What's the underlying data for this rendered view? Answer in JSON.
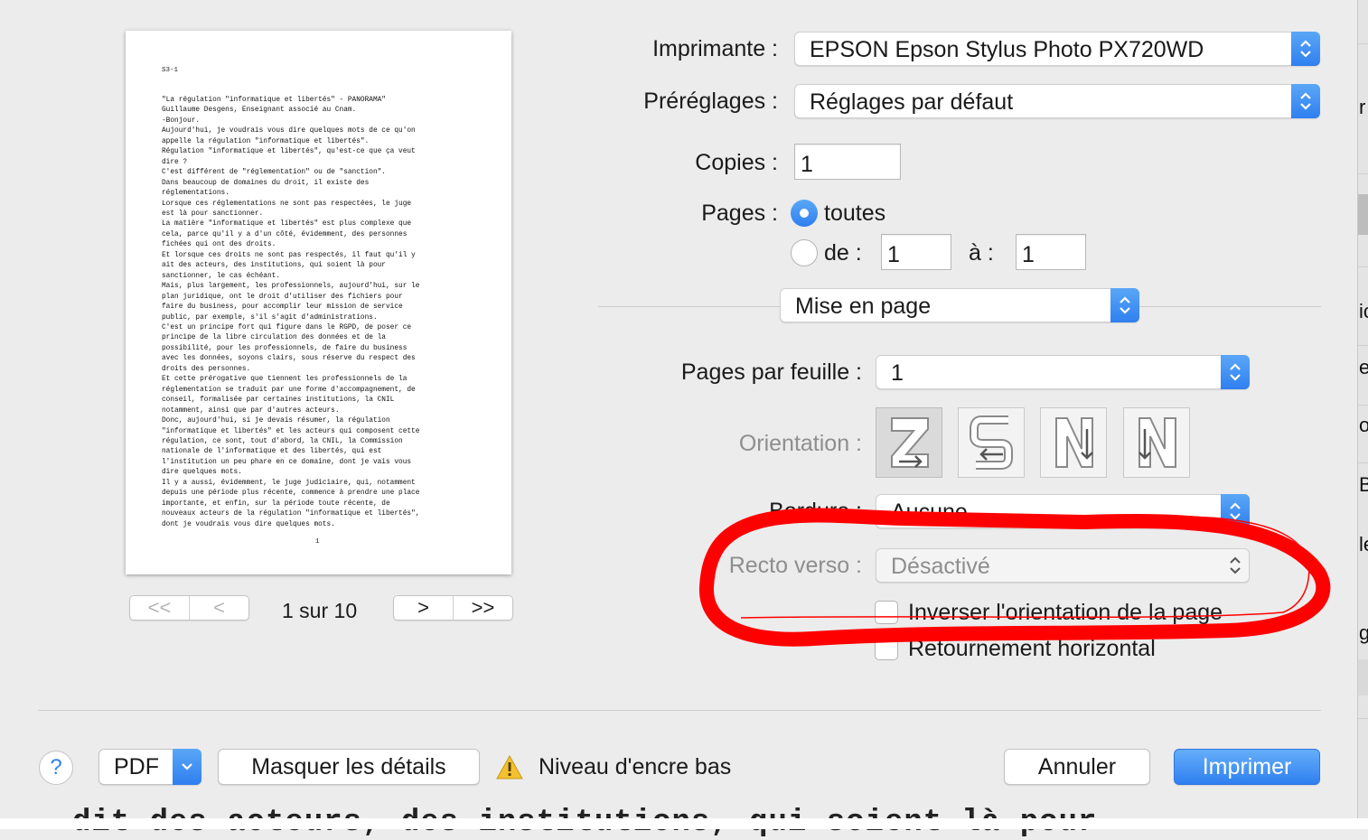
{
  "preview": {
    "doc_code": "S3-1",
    "page_number": "1",
    "lines": [
      "\"La régulation \"informatique et libertés\" - PANORAMA\"",
      "Guillaume Desgens, Enseignant associé au Cnam.",
      "-Bonjour.",
      "Aujourd'hui, je voudrais vous dire quelques mots de ce qu'on",
      "appelle la régulation \"informatique et libertés\".",
      "Régulation \"informatique et libertés\", qu'est-ce que ça veut",
      "dire ?",
      "C'est différent de \"réglementation\" ou de \"sanction\".",
      "Dans beaucoup de domaines du droit, il existe des",
      "réglementations.",
      "Lorsque ces réglementations ne sont pas respectées, le juge",
      "est là pour sanctionner.",
      "La matière \"informatique et libertés\" est plus complexe que",
      "cela, parce qu'il y a d'un côté, évidemment, des personnes",
      "fichées qui ont des droits.",
      "Et lorsque ces droits ne sont pas respectés, il faut qu'il y",
      "ait des acteurs, des institutions, qui soient là pour",
      "sanctionner, le cas échéant.",
      "Mais, plus largement, les professionnels, aujourd'hui, sur le",
      "plan juridique, ont le droit d'utiliser des fichiers pour",
      "faire du business, pour accomplir leur mission de service",
      "public, par exemple, s'il s'agit d'administrations.",
      "C'est un principe fort qui figure dans le RGPD, de poser ce",
      "principe de la libre circulation des données et de la",
      "possibilité, pour les professionnels, de faire du business",
      "avec les données, soyons clairs, sous réserve du respect des",
      "droits des personnes.",
      "Et cette prérogative que tiennent les professionnels de la",
      "réglementation se traduit par une forme d'accompagnement, de",
      "conseil, formalisée par certaines institutions, la CNIL",
      "notamment, ainsi que par d'autres acteurs.",
      "Donc, aujourd'hui, si je devais résumer, la régulation",
      "\"informatique et libertés\" et les acteurs qui composent cette",
      "régulation, ce sont, tout d'abord, la CNIL, la Commission",
      "nationale de l'informatique et des libertés, qui est",
      "l'institution un peu phare en ce domaine, dont je vais vous",
      "dire quelques mots.",
      "Il y a aussi, évidemment, le juge judiciaire, qui, notamment",
      "depuis une période plus récente, commence à prendre une place",
      "importante, et enfin, sur la période toute récente, de",
      "nouveaux acteurs de la régulation \"informatique et libertés\",",
      "dont je voudrais vous dire quelques mots."
    ],
    "page_indicator": "1 sur 10",
    "nav_first": "<<",
    "nav_prev": "<",
    "nav_next": ">",
    "nav_last": ">>"
  },
  "form": {
    "printer_label": "Imprimante :",
    "printer_value": "EPSON Epson Stylus Photo PX720WD",
    "presets_label": "Préréglages :",
    "presets_value": "Réglages par défaut",
    "copies_label": "Copies :",
    "copies_value": "1",
    "pages_label": "Pages :",
    "pages_all": "toutes",
    "pages_from_label": "de :",
    "pages_from_value": "1",
    "pages_to_label": "à :",
    "pages_to_value": "1",
    "section_value": "Mise en page",
    "pages_per_sheet_label": "Pages par feuille :",
    "pages_per_sheet_value": "1",
    "orientation_label": "Orientation :",
    "border_label": "Bordure :",
    "border_value": "Aucune",
    "duplex_label": "Recto verso :",
    "duplex_value": "Désactivé",
    "reverse_label": "Inverser l'orientation de la page",
    "flip_label": "Retournement horizontal"
  },
  "footer": {
    "help": "?",
    "pdf": "PDF",
    "hide_details": "Masquer les détails",
    "ink_warning": "Niveau d'encre bas",
    "cancel": "Annuler",
    "print": "Imprimer"
  },
  "background": {
    "behind_text": "dit des acteurs, des institutions, qui soient là pour",
    "strip_chars": [
      "r",
      "ic",
      "e",
      "o",
      "B",
      "le",
      "g"
    ]
  },
  "colors": {
    "accent": "#2f80f0",
    "annotation": "#ff0000"
  }
}
